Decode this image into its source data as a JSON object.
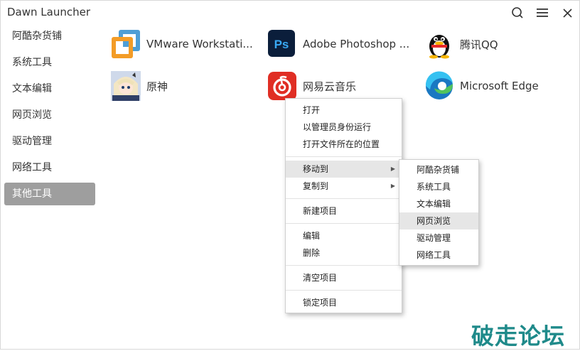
{
  "window": {
    "title": "Dawn Launcher"
  },
  "sidebar": {
    "items": [
      {
        "label": "阿酷杂货铺"
      },
      {
        "label": "系统工具"
      },
      {
        "label": "文本编辑"
      },
      {
        "label": "网页浏览"
      },
      {
        "label": "驱动管理"
      },
      {
        "label": "网络工具"
      },
      {
        "label": "其他工具",
        "active": true
      }
    ]
  },
  "apps": [
    {
      "label": "VMware Workstati...",
      "icon": "vmware-icon"
    },
    {
      "label": "Adobe Photoshop ...",
      "icon": "photoshop-icon",
      "icon_text": "Ps"
    },
    {
      "label": "腾讯QQ",
      "icon": "qq-penguin-icon"
    },
    {
      "label": "原神",
      "icon": "genshin-avatar-icon"
    },
    {
      "label": "网易云音乐",
      "icon": "netease-music-icon"
    },
    {
      "label": "Microsoft Edge",
      "icon": "edge-icon"
    }
  ],
  "context_menu": {
    "group1": [
      "打开",
      "以管理员身份运行",
      "打开文件所在的位置"
    ],
    "group2": [
      "移动到",
      "复制到"
    ],
    "group3": [
      "新建项目"
    ],
    "group4": [
      "编辑",
      "删除"
    ],
    "group5": [
      "清空项目"
    ],
    "group6": [
      "锁定项目"
    ]
  },
  "submenu": {
    "items": [
      "阿酷杂货铺",
      "系统工具",
      "文本编辑",
      "网页浏览",
      "驱动管理",
      "网络工具"
    ],
    "highlighted": "网页浏览"
  },
  "watermark": "破走论坛",
  "colors": {
    "active_sidebar": "#9e9e9e",
    "menu_highlight": "#e6e6e6",
    "watermark": "#1f8a8a"
  }
}
